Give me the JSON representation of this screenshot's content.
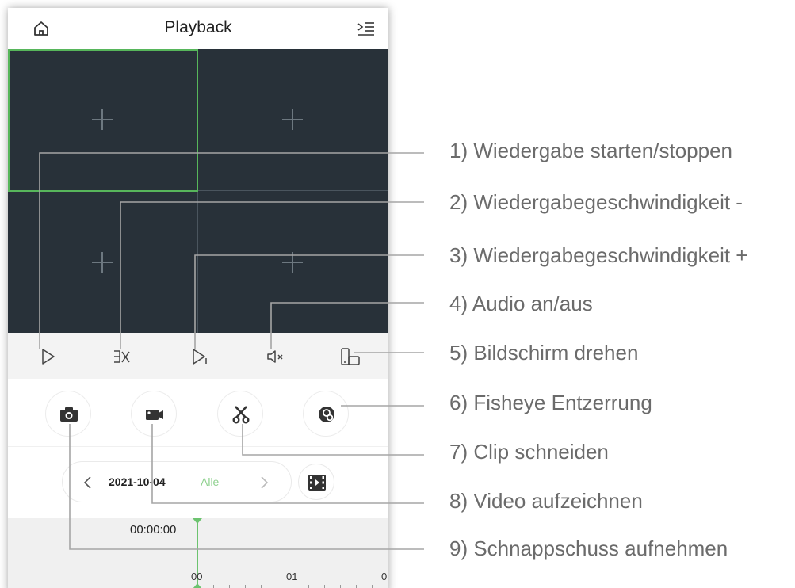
{
  "header": {
    "title": "Playback",
    "home_icon": "home-icon",
    "menu_icon": "list-collapse-icon"
  },
  "controls": [
    {
      "name": "play-icon"
    },
    {
      "name": "speed-down-icon"
    },
    {
      "name": "speed-up-icon"
    },
    {
      "name": "audio-mute-icon"
    },
    {
      "name": "rotate-screen-icon"
    }
  ],
  "tools": [
    {
      "name": "camera-icon"
    },
    {
      "name": "video-record-icon"
    },
    {
      "name": "scissors-icon"
    },
    {
      "name": "fisheye-icon"
    }
  ],
  "date_bar": {
    "date": "2021-10-04",
    "filter": "Alle"
  },
  "timeline": {
    "current_time": "00:00:00",
    "labels": [
      "00",
      "01",
      "0"
    ]
  },
  "callouts": [
    "1) Wiedergabe starten/stoppen",
    "2) Wiedergabegeschwindigkeit -",
    "3) Wiedergabegeschwindigkeit +",
    "4) Audio an/aus",
    "5) Bildschirm drehen",
    "6) Fisheye Entzerrung",
    "7) Clip schneiden",
    "8) Video aufzeichnen",
    "9) Schnappschuss aufnehmen"
  ],
  "colors": {
    "accent": "#57b65b",
    "video_bg": "#283139",
    "callout_text": "#6b6b6b"
  }
}
